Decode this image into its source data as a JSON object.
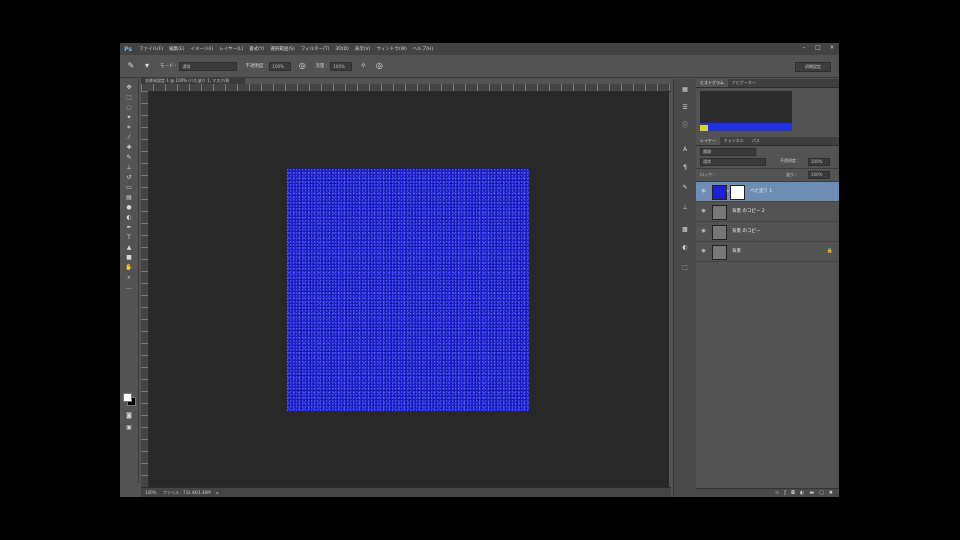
{
  "menu": {
    "logo": "Ps",
    "items": [
      "ファイル(F)",
      "編集(E)",
      "イメージ(I)",
      "レイヤー(L)",
      "書式(Y)",
      "選択範囲(S)",
      "フィルター(T)",
      "3D(D)",
      "表示(V)",
      "ウィンドウ(W)",
      "ヘルプ(H)"
    ]
  },
  "window_controls": {
    "minimize": "–",
    "maximize": "□",
    "close": "×"
  },
  "options": {
    "mode_label": "モード :",
    "mode_value": "通常",
    "opacity_label": "不透明度 :",
    "opacity_value": "100%",
    "flow_label": "流量 :",
    "flow_value": "100%",
    "workspace": "初期設定"
  },
  "document": {
    "tab": "名称未設定-1 @ 100% (べた塗り 1, マスク/8)"
  },
  "status": {
    "zoom": "100%",
    "doc_info": "ファイル : 732.4K/1.46M"
  },
  "panels": {
    "top_tabs": [
      "ヒストグラム",
      "ナビゲーター"
    ],
    "layer_tabs": [
      "レイヤー",
      "チャンネル",
      "パス"
    ],
    "kind_value": "種類",
    "blend_value": "通常",
    "opacity_label": "不透明度 :",
    "opacity_value": "100%",
    "lock_label": "ロック :",
    "fill_label": "塗り :",
    "fill_value": "100%"
  },
  "layers": [
    {
      "name": "べた塗り 1",
      "thumb_color": "#1a1fd8",
      "has_mask": true,
      "selected": true
    },
    {
      "name": "背景 のコピー 2",
      "thumb_color": "#777777",
      "has_mask": false,
      "selected": false
    },
    {
      "name": "背景 のコピー",
      "thumb_color": "#777777",
      "has_mask": false,
      "selected": false
    },
    {
      "name": "背景",
      "thumb_color": "#777777",
      "has_mask": false,
      "selected": false,
      "locked": true
    }
  ],
  "colors": {
    "fill": "#1a1fd8",
    "selected_layer": "#6d8db5"
  },
  "icons": {
    "eye": "eye-icon",
    "lock": "lock-icon",
    "link": "link-icon"
  }
}
